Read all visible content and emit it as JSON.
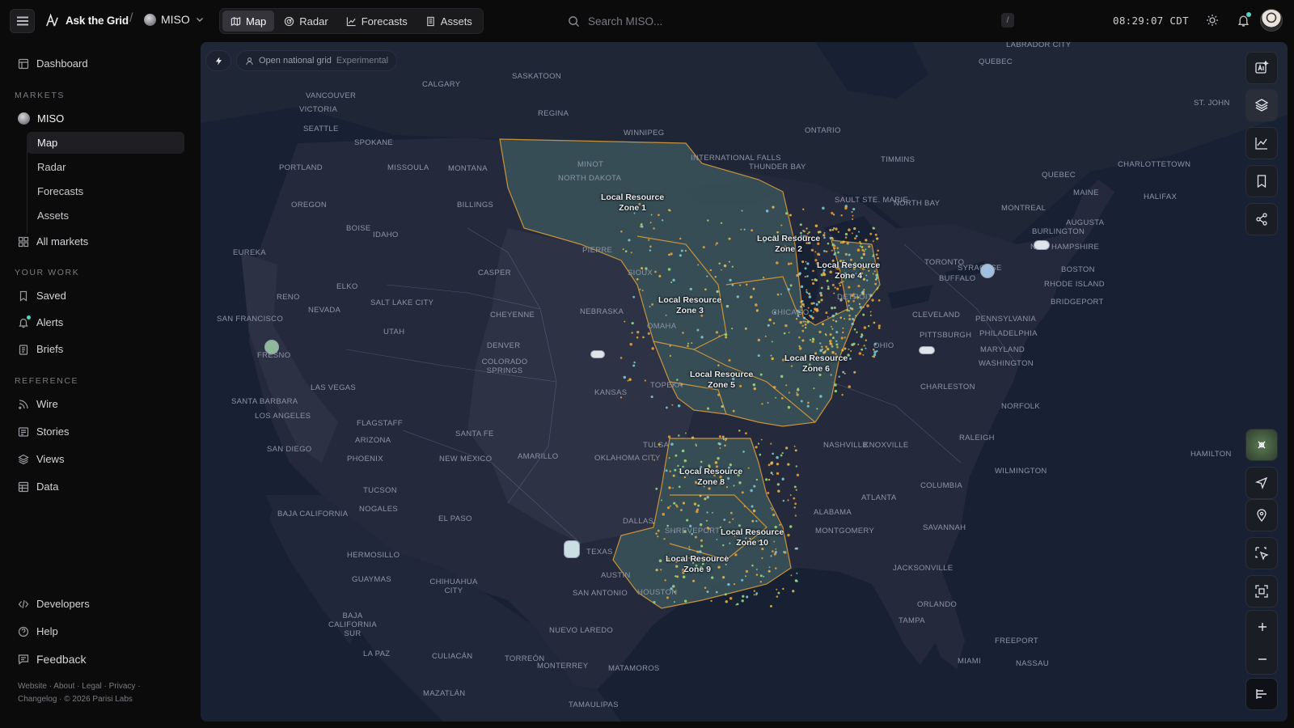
{
  "app": {
    "name": "Ask the Grid",
    "market": "MISO"
  },
  "nav_tabs": [
    {
      "label": "Map",
      "active": true
    },
    {
      "label": "Radar",
      "active": false
    },
    {
      "label": "Forecasts",
      "active": false
    },
    {
      "label": "Assets",
      "active": false
    }
  ],
  "search": {
    "placeholder": "Search MISO...",
    "shortcut": "/"
  },
  "clock": "08:29:07 CDT",
  "sidebar": {
    "dashboard": "Dashboard",
    "markets_header": "MARKETS",
    "market_item": "MISO",
    "market_sub": [
      "Map",
      "Radar",
      "Forecasts",
      "Assets"
    ],
    "all_markets": "All markets",
    "your_work_header": "YOUR WORK",
    "your_work": [
      "Saved",
      "Alerts",
      "Briefs"
    ],
    "reference_header": "REFERENCE",
    "reference": [
      "Wire",
      "Stories",
      "Views",
      "Data"
    ],
    "developers": "Developers",
    "help": "Help",
    "feedback": "Feedback",
    "footer_line1": "Website · About · Legal · Privacy ·",
    "footer_line2": "Changelog · © 2026 Parisi Labs"
  },
  "map": {
    "open_grid_label": "Open national grid",
    "open_grid_tag": "Experimental",
    "zones": [
      {
        "l1": "Local Resource",
        "l2": "Zone 1"
      },
      {
        "l1": "Local Resource",
        "l2": "Zone 2"
      },
      {
        "l1": "Local Resource",
        "l2": "Zone 3"
      },
      {
        "l1": "Local Resource",
        "l2": "Zone 4"
      },
      {
        "l1": "Local Resource",
        "l2": "Zone 5"
      },
      {
        "l1": "Local Resource",
        "l2": "Zone 6"
      },
      {
        "l1": "Local Resource",
        "l2": "Zone 8"
      },
      {
        "l1": "Local Resource",
        "l2": "Zone 9"
      },
      {
        "l1": "Local Resource",
        "l2": "Zone 10"
      }
    ],
    "places": [
      "LABRADOR CITY",
      "QUEBEC",
      "ST. JOHN",
      "SASKATOON",
      "CALGARY",
      "VANCOUVER",
      "VICTORIA",
      "REGINA",
      "SEATTLE",
      "SPOKANE",
      "WINNIPEG",
      "ONTARIO",
      "TIMMINS",
      "INTERNATIONAL FALLS",
      "THUNDER BAY",
      "MINOT",
      "NORTH DAKOTA",
      "PORTLAND",
      "MISSOULA",
      "MONTANA",
      "BILLINGS",
      "OREGON",
      "BOISE",
      "IDAHO",
      "SAULT STE. MARIE",
      "NORTH BAY",
      "QUEBEC",
      "CHARLOTTETOWN",
      "MAINE",
      "HALIFAX",
      "MONTREAL",
      "BURLINGTON",
      "AUGUSTA",
      "NEW HAMPSHIRE",
      "EUREKA",
      "PIERRE",
      "CASPER",
      "SIOUX",
      "TORONTO",
      "SYRACUSE",
      "BOSTON",
      "BUFFALO",
      "RHODE ISLAND",
      "BRIDGEPORT",
      "RENO",
      "NEVADA",
      "ELKO",
      "SALT LAKE CITY",
      "CHEYENNE",
      "NEBRASKA",
      "OMAHA",
      "CHICAGO",
      "DETROIT",
      "CLEVELAND",
      "PENNSYLVANIA",
      "SAN FRANCISCO",
      "UTAH",
      "DENVER",
      "COLORADO SPRINGS",
      "PITTSBURGH",
      "PHILADELPHIA",
      "OHIO",
      "MARYLAND",
      "WASHINGTON",
      "FRESNO",
      "KANSAS",
      "TOPEKA",
      "CHARLESTON",
      "LAS VEGAS",
      "SANTA BARBARA",
      "LOS ANGELES",
      "FLAGSTAFF",
      "ARIZONA",
      "SANTA FE",
      "TULSA",
      "NORFOLK",
      "NASHVILLE",
      "KNOXVILLE",
      "RALEIGH",
      "SAN DIEGO",
      "PHOENIX",
      "NEW MEXICO",
      "AMARILLO",
      "OKLAHOMA CITY",
      "HAMILTON",
      "WILMINGTON",
      "TUCSON",
      "NOGALES",
      "COLUMBIA",
      "ATLANTA",
      "BAJA CALIFORNIA",
      "EL PASO",
      "DALLAS",
      "SHREVEPORT",
      "ALABAMA",
      "MONTGOMERY",
      "SAVANNAH",
      "HERMOSILLO",
      "TEXAS",
      "GUAYMAS",
      "CHIHUAHUA CITY",
      "AUSTIN",
      "HOUSTON",
      "JACKSONVILLE",
      "SAN ANTONIO",
      "ORLANDO",
      "TAMPA",
      "BAJA CALIFORNIA SUR",
      "NUEVO LAREDO",
      "LA PAZ",
      "CULIACÁN",
      "TORREÓN",
      "MONTERREY",
      "MATAMOROS",
      "FREEPORT",
      "MIAMI",
      "NASSAU",
      "MAZATLÁN",
      "TAMAULIPAS"
    ]
  }
}
